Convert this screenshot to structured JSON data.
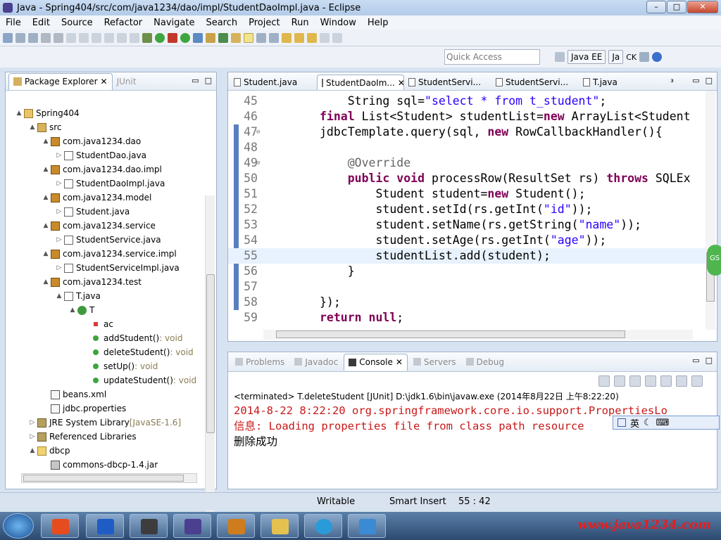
{
  "window": {
    "title": "Java - Spring404/src/com/java1234/dao/impl/StudentDaoImpl.java - Eclipse",
    "buttons": [
      "–",
      "□",
      "✕"
    ]
  },
  "menu": [
    "File",
    "Edit",
    "Source",
    "Refactor",
    "Navigate",
    "Search",
    "Project",
    "Run",
    "Window",
    "Help"
  ],
  "quick_access": {
    "placeholder": "Quick Access"
  },
  "perspectives": {
    "javaee": "Java EE",
    "ja": "Ja",
    "ck": "CK"
  },
  "package_explorer": {
    "tabs": [
      "Package Explorer",
      "JUnit"
    ],
    "tree": [
      {
        "label": "Spring404",
        "depth": 0,
        "expand": "▲",
        "icon": "proj"
      },
      {
        "label": "src",
        "depth": 1,
        "expand": "▲",
        "icon": "src"
      },
      {
        "label": "com.java1234.dao",
        "depth": 2,
        "expand": "▲",
        "icon": "pkg"
      },
      {
        "label": "StudentDao.java",
        "depth": 3,
        "expand": "▷",
        "icon": "java"
      },
      {
        "label": "com.java1234.dao.impl",
        "depth": 2,
        "expand": "▲",
        "icon": "pkg"
      },
      {
        "label": "StudentDaoImpl.java",
        "depth": 3,
        "expand": "▷",
        "icon": "java"
      },
      {
        "label": "com.java1234.model",
        "depth": 2,
        "expand": "▲",
        "icon": "pkg"
      },
      {
        "label": "Student.java",
        "depth": 3,
        "expand": "▷",
        "icon": "java"
      },
      {
        "label": "com.java1234.service",
        "depth": 2,
        "expand": "▲",
        "icon": "pkg"
      },
      {
        "label": "StudentService.java",
        "depth": 3,
        "expand": "▷",
        "icon": "java"
      },
      {
        "label": "com.java1234.service.impl",
        "depth": 2,
        "expand": "▲",
        "icon": "pkg"
      },
      {
        "label": "StudentServiceImpl.java",
        "depth": 3,
        "expand": "▷",
        "icon": "java"
      },
      {
        "label": "com.java1234.test",
        "depth": 2,
        "expand": "▲",
        "icon": "pkg"
      },
      {
        "label": "T.java",
        "depth": 3,
        "expand": "▲",
        "icon": "java"
      },
      {
        "label": "T",
        "depth": 4,
        "expand": "▲",
        "icon": "class"
      },
      {
        "label": "ac",
        "depth": 5,
        "expand": "",
        "icon": "field"
      },
      {
        "label": "addStudent()",
        "suffix": " : void",
        "depth": 5,
        "expand": "",
        "icon": "meth"
      },
      {
        "label": "deleteStudent()",
        "suffix": " : void",
        "depth": 5,
        "expand": "",
        "icon": "meth"
      },
      {
        "label": "setUp()",
        "suffix": " : void",
        "depth": 5,
        "expand": "",
        "icon": "meth"
      },
      {
        "label": "updateStudent()",
        "suffix": " : void",
        "depth": 5,
        "expand": "",
        "icon": "meth"
      },
      {
        "label": "beans.xml",
        "depth": 2,
        "expand": "",
        "icon": "xml"
      },
      {
        "label": "jdbc.properties",
        "depth": 2,
        "expand": "",
        "icon": "xml"
      },
      {
        "label": "JRE System Library",
        "suffix": " [JavaSE-1.6]",
        "depth": 1,
        "expand": "▷",
        "icon": "lib"
      },
      {
        "label": "Referenced Libraries",
        "depth": 1,
        "expand": "▷",
        "icon": "lib"
      },
      {
        "label": "dbcp",
        "depth": 1,
        "expand": "▲",
        "icon": "folder"
      },
      {
        "label": "commons-dbcp-1.4.jar",
        "depth": 2,
        "expand": "",
        "icon": "jar"
      }
    ]
  },
  "editor": {
    "tabs": [
      "Student.java",
      "StudentDaoIm...",
      "StudentServi...",
      "StudentServi...",
      "T.java",
      "³"
    ],
    "lines": [
      {
        "n": "45",
        "fold": "",
        "code": [
          [
            "",
            "    String sql="
          ],
          [
            "str",
            "\"select * from t_student\""
          ],
          [
            "",
            ";"
          ]
        ]
      },
      {
        "n": "46",
        "fold": "",
        "code": [
          [
            "kw",
            "final"
          ],
          [
            "",
            " List<Student> studentList="
          ],
          [
            "kw",
            "new"
          ],
          [
            "",
            " ArrayList<Student"
          ]
        ]
      },
      {
        "n": "47",
        "fold": "⊖",
        "code": [
          [
            "",
            "jdbcTemplate.query(sql, "
          ],
          [
            "kw",
            "new"
          ],
          [
            "",
            " RowCallbackHandler(){"
          ]
        ]
      },
      {
        "n": "48",
        "fold": "",
        "code": [
          [
            "",
            ""
          ]
        ]
      },
      {
        "n": "49",
        "fold": "⊖",
        "code": [
          [
            "",
            "    "
          ],
          [
            "ann",
            "@Override"
          ]
        ]
      },
      {
        "n": "50",
        "fold": "",
        "code": [
          [
            "",
            "    "
          ],
          [
            "kw",
            "public"
          ],
          [
            "",
            " "
          ],
          [
            "kw",
            "void"
          ],
          [
            "",
            " processRow(ResultSet rs) "
          ],
          [
            "kw",
            "throws"
          ],
          [
            "",
            " SQLEx"
          ]
        ]
      },
      {
        "n": "51",
        "fold": "",
        "code": [
          [
            "",
            "        Student student="
          ],
          [
            "kw",
            "new"
          ],
          [
            "",
            " Student();"
          ]
        ]
      },
      {
        "n": "52",
        "fold": "",
        "code": [
          [
            "",
            "        student.setId(rs.getInt("
          ],
          [
            "str",
            "\"id\""
          ],
          [
            "",
            "));"
          ]
        ]
      },
      {
        "n": "53",
        "fold": "",
        "code": [
          [
            "",
            "        student.setName(rs.getString("
          ],
          [
            "str",
            "\"name\""
          ],
          [
            "",
            "));"
          ]
        ]
      },
      {
        "n": "54",
        "fold": "",
        "code": [
          [
            "",
            "        student.setAge(rs.getInt("
          ],
          [
            "str",
            "\"age\""
          ],
          [
            "",
            "));"
          ]
        ]
      },
      {
        "n": "55",
        "fold": "",
        "code": [
          [
            "",
            "        studentList.add(student);"
          ]
        ]
      },
      {
        "n": "56",
        "fold": "",
        "code": [
          [
            "",
            "    }"
          ]
        ]
      },
      {
        "n": "57",
        "fold": "",
        "code": [
          [
            "",
            ""
          ]
        ]
      },
      {
        "n": "58",
        "fold": "",
        "code": [
          [
            "",
            "});"
          ]
        ]
      },
      {
        "n": "59",
        "fold": "",
        "code": [
          [
            "kw",
            "return"
          ],
          [
            "",
            " "
          ],
          [
            "kw",
            "null"
          ],
          [
            "",
            ";"
          ]
        ]
      }
    ]
  },
  "console": {
    "tabs": [
      "Problems",
      "Javadoc",
      "Console",
      "Servers",
      "Debug"
    ],
    "terminated": "<terminated> T.deleteStudent [JUnit] D:\\jdk1.6\\bin\\javaw.exe (2014年8月22日 上午8:22:20)",
    "line1": "2014-8-22 8:22:20 org.springframework.core.io.support.PropertiesLo",
    "line2": "信息: Loading properties file from class path resource",
    "line3": "删除成功"
  },
  "ime": {
    "lang": "英"
  },
  "status": {
    "writable": "Writable",
    "insert": "Smart Insert",
    "pos": "55 : 42"
  },
  "taskbar": {
    "site": "www.java1234.com",
    "gs": "GS"
  }
}
